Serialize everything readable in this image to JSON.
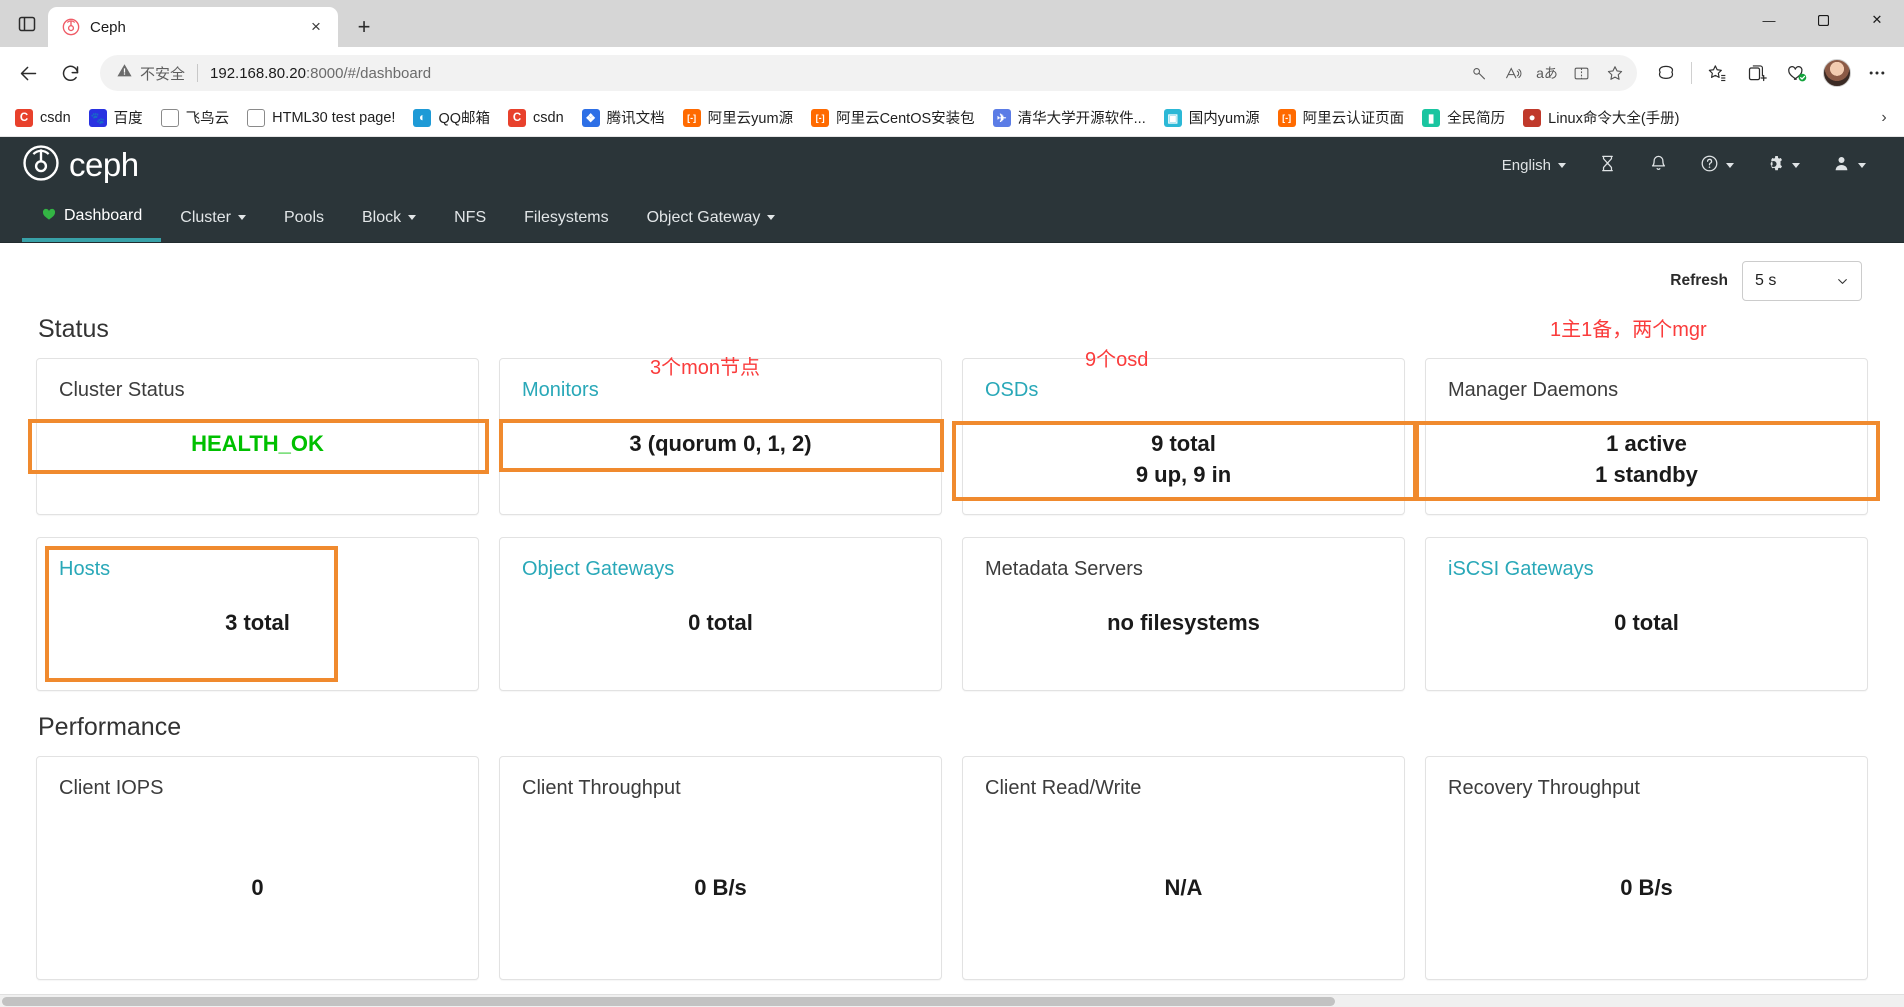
{
  "browser": {
    "tab": {
      "title": "Ceph",
      "favicon": "ceph-favicon",
      "close_label": "×"
    },
    "new_tab_label": "+",
    "tab_search_label": "tab-search",
    "window_controls": {
      "minimize": "—",
      "maximize": "❐",
      "close": "✕"
    },
    "nav": {
      "back": "←",
      "reload": "↻"
    },
    "omnibox": {
      "security_warning": "不安全",
      "url_host": "192.168.80.20",
      "url_rest": ":8000/#/dashboard",
      "actions": [
        "key-icon",
        "read-aloud-icon",
        "translate-icon",
        "split-screen-icon",
        "favorite-star-icon"
      ]
    },
    "toolbar_icons": [
      "copilot-icon",
      "favorites-icon",
      "collections-icon",
      "browser-essentials-icon",
      "profile-avatar",
      "settings-more-icon"
    ],
    "bookmarks": [
      {
        "label": "csdn",
        "icon": "csdn-icon",
        "color": "#e8412c",
        "glyph": "C"
      },
      {
        "label": "百度",
        "icon": "baidu-icon",
        "color": "#2932e1",
        "glyph": "🐾"
      },
      {
        "label": "飞鸟云",
        "icon": "page-icon",
        "color": "#7a7a7a",
        "glyph": "⬜"
      },
      {
        "label": "HTML30 test page!",
        "icon": "page-icon",
        "color": "#7a7a7a",
        "glyph": "⬜"
      },
      {
        "label": "QQ邮箱",
        "icon": "qqmail-icon",
        "color": "#1e9ad6",
        "glyph": "◐"
      },
      {
        "label": "csdn",
        "icon": "csdn-icon",
        "color": "#e8412c",
        "glyph": "C"
      },
      {
        "label": "腾讯文档",
        "icon": "tencent-docs-icon",
        "color": "#2d6fe6",
        "glyph": "❖"
      },
      {
        "label": "阿里云yum源",
        "icon": "aliyun-icon",
        "color": "#ff6a00",
        "glyph": "[-]"
      },
      {
        "label": "阿里云CentOS安装包",
        "icon": "aliyun-icon",
        "color": "#ff6a00",
        "glyph": "[-]"
      },
      {
        "label": "清华大学开源软件...",
        "icon": "tuna-icon",
        "color": "#5b7ce6",
        "glyph": "✈"
      },
      {
        "label": "国内yum源",
        "icon": "bilibili-icon",
        "color": "#2bb8d6",
        "glyph": "▣"
      },
      {
        "label": "阿里云认证页面",
        "icon": "aliyun-icon",
        "color": "#ff6a00",
        "glyph": "[-]"
      },
      {
        "label": "全民简历",
        "icon": "resume-icon",
        "color": "#19c5a0",
        "glyph": "▮"
      },
      {
        "label": "Linux命令大全(手册)",
        "icon": "linux-icon",
        "color": "#c0392b",
        "glyph": "●"
      }
    ],
    "bookmarks_overflow_label": "›"
  },
  "ceph": {
    "brand": "ceph",
    "header": {
      "language": "English",
      "icons": [
        "hourglass-icon",
        "bell-icon",
        "help-icon",
        "gear-icon",
        "user-icon"
      ]
    },
    "nav": [
      {
        "label": "Dashboard",
        "active": true,
        "caret": false,
        "icon": "heart-icon"
      },
      {
        "label": "Cluster",
        "active": false,
        "caret": true
      },
      {
        "label": "Pools",
        "active": false,
        "caret": false
      },
      {
        "label": "Block",
        "active": false,
        "caret": true
      },
      {
        "label": "NFS",
        "active": false,
        "caret": false
      },
      {
        "label": "Filesystems",
        "active": false,
        "caret": false
      },
      {
        "label": "Object Gateway",
        "active": false,
        "caret": true
      }
    ],
    "refresh": {
      "label": "Refresh",
      "value": "5 s"
    },
    "status": {
      "heading": "Status",
      "cards": [
        {
          "title": "Cluster Status",
          "link": false,
          "value": "HEALTH_OK"
        },
        {
          "title": "Monitors",
          "link": true,
          "value": "3 (quorum 0, 1, 2)"
        },
        {
          "title": "OSDs",
          "link": true,
          "value": "9 total\n9 up, 9 in"
        },
        {
          "title": "Manager Daemons",
          "link": false,
          "value": "1 active\n1 standby"
        },
        {
          "title": "Hosts",
          "link": true,
          "value": "3 total"
        },
        {
          "title": "Object Gateways",
          "link": true,
          "value": "0 total"
        },
        {
          "title": "Metadata Servers",
          "link": false,
          "value": "no filesystems"
        },
        {
          "title": "iSCSI Gateways",
          "link": true,
          "value": "0 total"
        }
      ]
    },
    "performance": {
      "heading": "Performance",
      "cards": [
        {
          "title": "Client IOPS",
          "value": "0"
        },
        {
          "title": "Client Throughput",
          "value": "0 B/s"
        },
        {
          "title": "Client Read/Write",
          "value": "N/A"
        },
        {
          "title": "Recovery Throughput",
          "value": "0 B/s"
        }
      ]
    },
    "annotations": [
      {
        "text": "3个mon节点",
        "target": "monitors"
      },
      {
        "text": "9个osd",
        "target": "osds"
      },
      {
        "text": "1主1备，两个mgr",
        "target": "manager-daemons"
      }
    ],
    "colors": {
      "accent_teal": "#29a8b8",
      "header_bg": "#2b3539",
      "health_ok": "#00c000",
      "annotation_box": "#f08a2e",
      "annotation_text": "#fa3c3c"
    }
  }
}
